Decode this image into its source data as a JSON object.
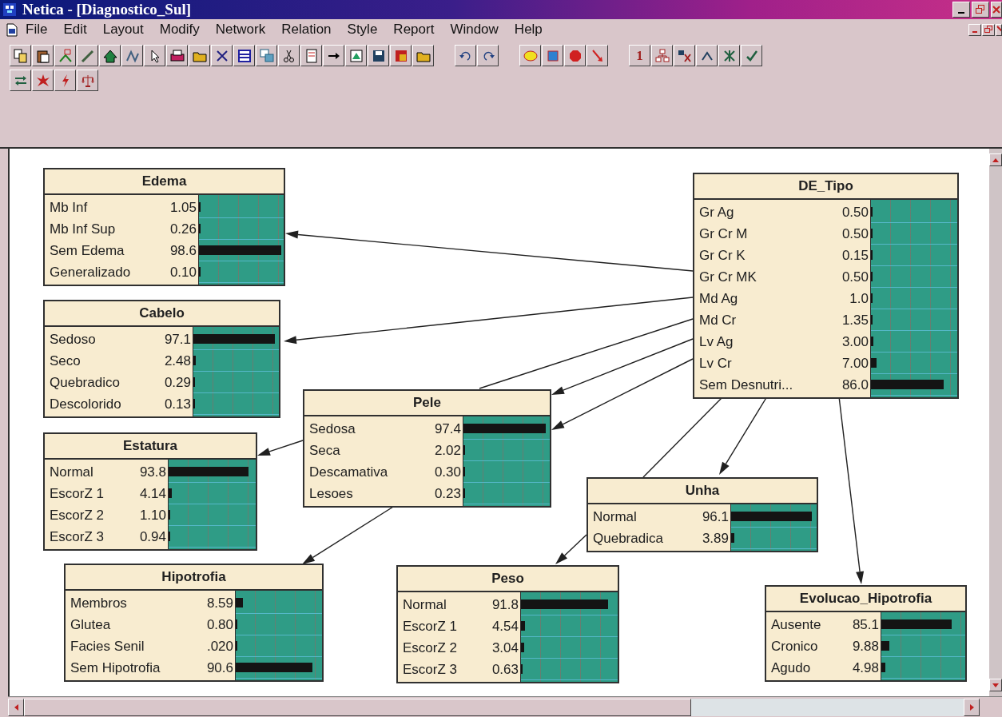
{
  "window": {
    "title": "Netica - [Diagnostico_Sul]"
  },
  "menu": [
    "File",
    "Edit",
    "Layout",
    "Modify",
    "Network",
    "Relation",
    "Style",
    "Report",
    "Window",
    "Help"
  ],
  "toolbar": {
    "number_button": "1"
  },
  "nodes": [
    {
      "title": "Edema",
      "states": [
        {
          "name": "Mb Inf",
          "value": "1.05",
          "level": 0.0105
        },
        {
          "name": "Mb Inf Sup",
          "value": "0.26",
          "level": 0.0026
        },
        {
          "name": "Sem Edema",
          "value": "98.6",
          "level": 0.986
        },
        {
          "name": "Generalizado",
          "value": "0.10",
          "level": 0.001
        }
      ]
    },
    {
      "title": "Cabelo",
      "states": [
        {
          "name": "Sedoso",
          "value": "97.1",
          "level": 0.971
        },
        {
          "name": "Seco",
          "value": "2.48",
          "level": 0.0248
        },
        {
          "name": "Quebradico",
          "value": "0.29",
          "level": 0.0029
        },
        {
          "name": "Descolorido",
          "value": "0.13",
          "level": 0.0013
        }
      ]
    },
    {
      "title": "Estatura",
      "states": [
        {
          "name": "Normal",
          "value": "93.8",
          "level": 0.938
        },
        {
          "name": "EscorZ 1",
          "value": "4.14",
          "level": 0.0414
        },
        {
          "name": "EscorZ 2",
          "value": "1.10",
          "level": 0.011
        },
        {
          "name": "EscorZ 3",
          "value": "0.94",
          "level": 0.0094
        }
      ]
    },
    {
      "title": "Hipotrofia",
      "states": [
        {
          "name": "Membros",
          "value": "8.59",
          "level": 0.0859
        },
        {
          "name": "Glutea",
          "value": "0.80",
          "level": 0.008
        },
        {
          "name": "Facies Senil",
          "value": ".020",
          "level": 0.0002
        },
        {
          "name": "Sem Hipotrofia",
          "value": "90.6",
          "level": 0.906
        }
      ]
    },
    {
      "title": "Pele",
      "states": [
        {
          "name": "Sedosa",
          "value": "97.4",
          "level": 0.974
        },
        {
          "name": "Seca",
          "value": "2.02",
          "level": 0.0202
        },
        {
          "name": "Descamativa",
          "value": "0.30",
          "level": 0.003
        },
        {
          "name": "Lesoes",
          "value": "0.23",
          "level": 0.0023
        }
      ]
    },
    {
      "title": "Peso",
      "states": [
        {
          "name": "Normal",
          "value": "91.8",
          "level": 0.918
        },
        {
          "name": "EscorZ 1",
          "value": "4.54",
          "level": 0.0454
        },
        {
          "name": "EscorZ 2",
          "value": "3.04",
          "level": 0.0304
        },
        {
          "name": "EscorZ 3",
          "value": "0.63",
          "level": 0.0063
        }
      ]
    },
    {
      "title": "Unha",
      "states": [
        {
          "name": "Normal",
          "value": "96.1",
          "level": 0.961
        },
        {
          "name": "Quebradica",
          "value": "3.89",
          "level": 0.0389
        }
      ]
    },
    {
      "title": "DE_Tipo",
      "states": [
        {
          "name": "Gr Ag",
          "value": "0.50",
          "level": 0.005
        },
        {
          "name": "Gr Cr M",
          "value": "0.50",
          "level": 0.005
        },
        {
          "name": "Gr Cr K",
          "value": "0.15",
          "level": 0.0015
        },
        {
          "name": "Gr Cr MK",
          "value": "0.50",
          "level": 0.005
        },
        {
          "name": "Md Ag",
          "value": "1.0",
          "level": 0.01
        },
        {
          "name": "Md Cr",
          "value": "1.35",
          "level": 0.0135
        },
        {
          "name": "Lv Ag",
          "value": "3.00",
          "level": 0.03
        },
        {
          "name": "Lv Cr",
          "value": "7.00",
          "level": 0.07
        },
        {
          "name": "Sem Desnutri...",
          "value": "86.0",
          "level": 0.86
        }
      ]
    },
    {
      "title": "Evolucao_Hipotrofia",
      "states": [
        {
          "name": "Ausente",
          "value": "85.1",
          "level": 0.851
        },
        {
          "name": "Cronico",
          "value": "9.88",
          "level": 0.0988
        },
        {
          "name": "Agudo",
          "value": "4.98",
          "level": 0.0498
        }
      ]
    }
  ]
}
